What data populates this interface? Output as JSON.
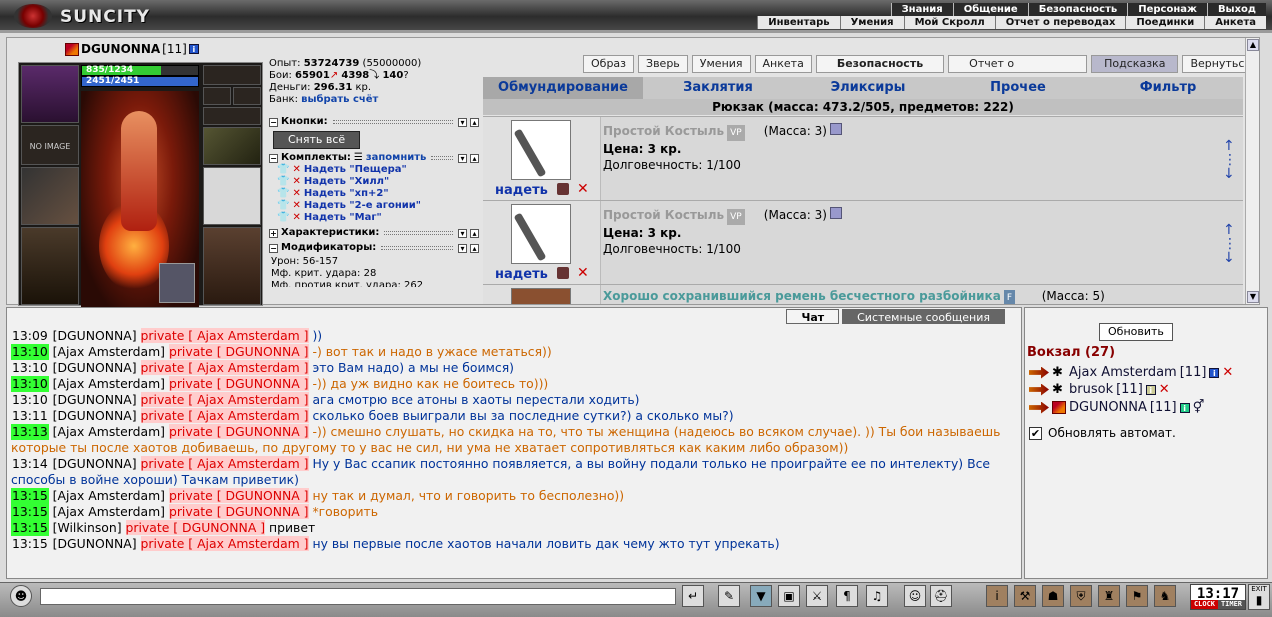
{
  "header": {
    "logo_text": "SUNCITY",
    "menu_top": [
      "Знания",
      "Общение",
      "Безопасность",
      "Персонаж",
      "Выход"
    ],
    "menu_bottom": [
      "Инвентарь",
      "Умения",
      "Мой Скролл",
      "Отчет о переводах",
      "Поединки",
      "Анкета"
    ]
  },
  "character": {
    "nick": "DGUNONNA",
    "level": "[11]",
    "hp": "835/1234",
    "hp_fraction": 0.677,
    "mp": "2451/2451",
    "mp_fraction": 1.0,
    "no_image": "NO IMAGE"
  },
  "stats": {
    "exp_label": "Опыт:",
    "exp_value": "53724739",
    "exp_next": "(55000000)",
    "fights_label": "Бои:",
    "wins": "65901",
    "losses": "4398",
    "draws": "140",
    "money_label": "Деньги:",
    "money_value": "296.31",
    "money_unit": "кр.",
    "bank_label": "Банк:",
    "bank_link": "выбрать счёт",
    "buttons_section": "Кнопки:",
    "remove_all": "Снять всё",
    "kits_section": "Комплекты:",
    "remember": "запомнить",
    "kits": [
      "Надеть \"Пещера\"",
      "Надеть \"Хилл\"",
      "Надеть \"хп+2\"",
      "Надеть \"2-е агонии\"",
      "Надеть \"Маг\""
    ],
    "chars_section": "Характеристики:",
    "mods_section": "Модификаторы:",
    "damage": "Урон: 56-157",
    "crit": "Мф. крит. удара: 28",
    "crit2": "Мф. против крит. удара: 262"
  },
  "toolbar": [
    "Образ",
    "Зверь",
    "Умения",
    "Анкета",
    "Безопасность",
    "Отчет о переводах",
    "Подсказка",
    "Вернуться"
  ],
  "inv_tabs": [
    "Обмундирование",
    "Заклятия",
    "Эликсиры",
    "Прочее",
    "Фильтр"
  ],
  "backpack_title": "Рюкзак (масса: 473.2/505, предметов: 222)",
  "items": [
    {
      "name": "Простой Костыль",
      "badge": "VP",
      "mass": "(Масса: 3)",
      "price": "Цена: 3 кр.",
      "durability": "Долговечность: 1/100",
      "action": "надеть"
    },
    {
      "name": "Простой Костыль",
      "badge": "VP",
      "mass": "(Масса: 3)",
      "price": "Цена: 3 кр.",
      "durability": "Долговечность: 1/100",
      "action": "надеть"
    },
    {
      "name": "Хорошо сохранившийся ремень бесчестного разбойника",
      "badge": "F",
      "mass": "(Масса: 5)",
      "price": "",
      "durability": "",
      "action": ""
    }
  ],
  "chat": {
    "tab_chat": "Чат",
    "tab_system": "Системные сообщения",
    "messages": [
      {
        "time": "13:09",
        "hl": false,
        "from": "[DGUNONNA]",
        "priv": "private [ Ajax Amsterdam ]",
        "text": "))",
        "color": "tx3"
      },
      {
        "time": "13:10",
        "hl": true,
        "from": "[Ajax Amsterdam]",
        "priv": "private [ DGUNONNA ]",
        "text": "-) вот так и надо в ужасе метаться))",
        "color": "tx2"
      },
      {
        "time": "13:10",
        "hl": false,
        "from": "[DGUNONNA]",
        "priv": "private [ Ajax Amsterdam ]",
        "text": "это Вам надо) а мы не боимся)",
        "color": "tx3"
      },
      {
        "time": "13:10",
        "hl": true,
        "from": "[Ajax Amsterdam]",
        "priv": "private [ DGUNONNA ]",
        "text": "-)) да уж видно как не боитесь то)))",
        "color": "tx2"
      },
      {
        "time": "13:10",
        "hl": false,
        "from": "[DGUNONNA]",
        "priv": "private [ Ajax Amsterdam ]",
        "text": "ага смотрю все атоны в хаоты перестали ходить)",
        "color": "tx3"
      },
      {
        "time": "13:11",
        "hl": false,
        "from": "[DGUNONNA]",
        "priv": "private [ Ajax Amsterdam ]",
        "text": "сколько боев выиграли вы за последние сутки?) а сколько мы?)",
        "color": "tx3"
      },
      {
        "time": "13:13",
        "hl": true,
        "from": "[Ajax Amsterdam]",
        "priv": "private [ DGUNONNA ]",
        "text": "-)) смешно слушать, но скидка на то, что ты женщина (надеюсь во всяком случае). )) Ты бои называешь которые ты после хаотов добиваешь, по другому то у вас не сил, ни ума не хватает сопротивляться как каким либо образом))",
        "color": "tx2"
      },
      {
        "time": "13:14",
        "hl": false,
        "from": "[DGUNONNA]",
        "priv": "private [ Ajax Amsterdam ]",
        "text": "Ну у Вас ссапик постоянно появляется, а вы войну подали только не проиграйте ее по интелекту) Все способы в войне хороши) Тачкам приветик)",
        "color": "tx3"
      },
      {
        "time": "13:15",
        "hl": true,
        "from": "[Ajax Amsterdam]",
        "priv": "private [ DGUNONNA ]",
        "text": "ну так и думал, что и говорить то бесполезно))",
        "color": "tx2"
      },
      {
        "time": "13:15",
        "hl": true,
        "from": "[Ajax Amsterdam]",
        "priv": "private [ DGUNONNA ]",
        "text": "*говорить",
        "color": "tx2"
      },
      {
        "time": "13:15",
        "hl": true,
        "from": "[Wilkinson]",
        "priv": "private [ DGUNONNA ]",
        "text": "привет",
        "color": "tx1"
      },
      {
        "time": "13:15",
        "hl": false,
        "from": "[DGUNONNA]",
        "priv": "private [ Ajax Amsterdam ]",
        "text": "ну вы первые после хаотов начали ловить дак чему жто тут упрекать)",
        "color": "tx3"
      }
    ]
  },
  "sidebar": {
    "refresh": "Обновить",
    "location": "Вокзал (27)",
    "users": [
      {
        "name": "Ajax Amsterdam",
        "level": "[11]"
      },
      {
        "name": "brusok",
        "level": "[11]"
      },
      {
        "name": "DGUNONNA",
        "level": "[11]"
      }
    ],
    "auto_refresh": "Обновлять автомат."
  },
  "clock": {
    "time": "13:17",
    "clock_label": "CLOCK",
    "timer_label": "TIMER",
    "exit_label": "EXIT"
  }
}
